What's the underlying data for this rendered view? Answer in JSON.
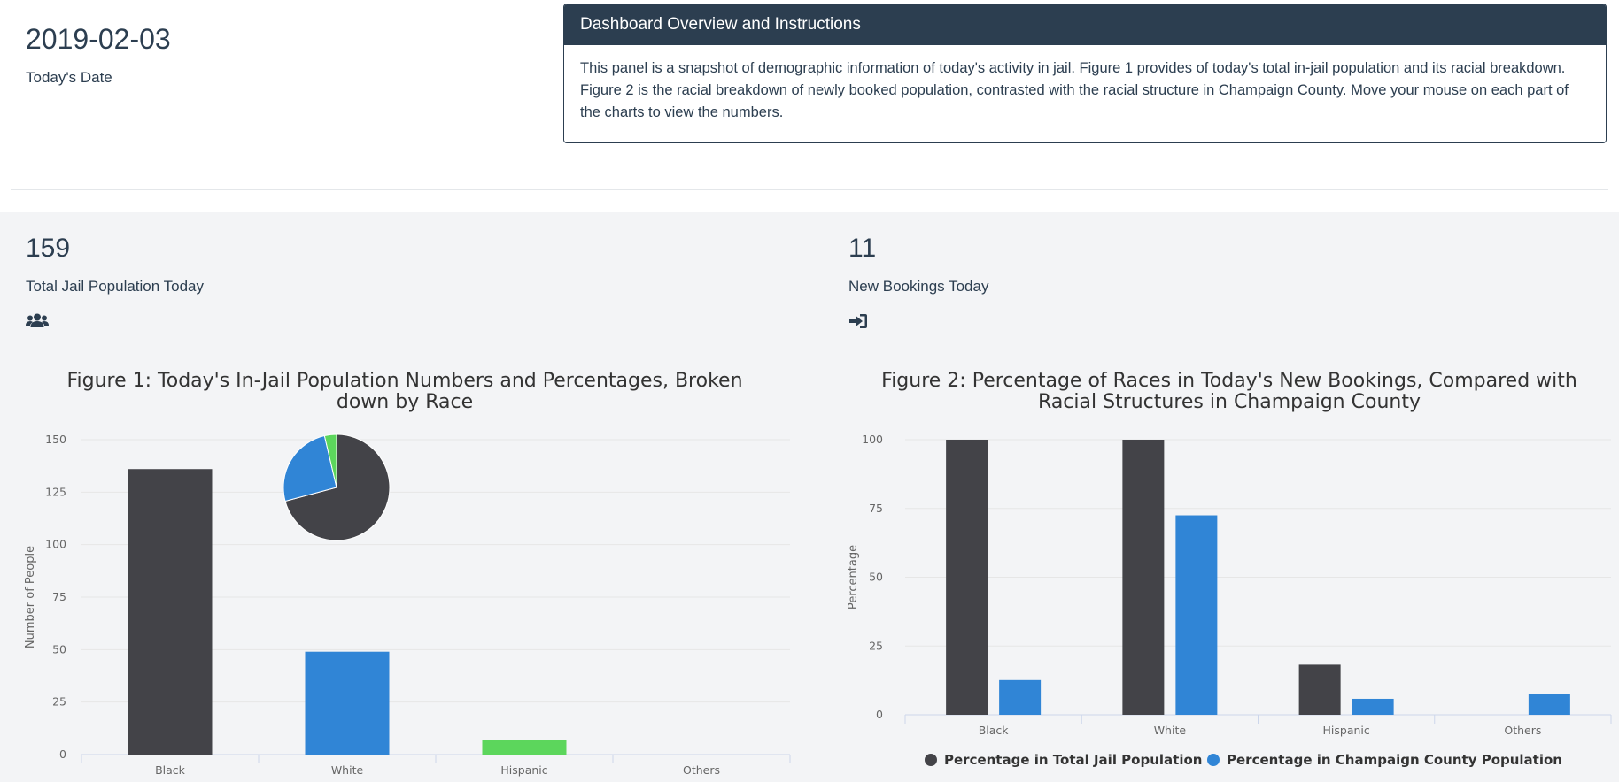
{
  "header": {
    "date": "2019-02-03",
    "date_label": "Today's Date"
  },
  "panel": {
    "title": "Dashboard Overview and Instructions",
    "body": "This panel is a snapshot of demographic information of today's activity in jail. Figure 1 provides of today's total in-jail population and its racial breakdown. Figure 2 is the racial breakdown of newly booked population, contrasted with the racial structure in Champaign County. Move your mouse on each part of the charts to view the numbers."
  },
  "stats": {
    "jail": {
      "value": "159",
      "label": "Total Jail Population Today",
      "icon": "users-icon"
    },
    "bookings": {
      "value": "11",
      "label": "New Bookings Today",
      "icon": "sign-in-icon"
    }
  },
  "colors": {
    "dark": "#434348",
    "blue": "#3085d6",
    "green": "#5cd65c",
    "navy": "#2c3e50"
  },
  "chart_data": [
    {
      "type": "bar",
      "title": "Figure 1: Today's In-Jail Population Numbers and Percentages, Broken down by Race",
      "title_lines": [
        "Figure 1: Today's In-Jail Population Numbers and Percentages, Broken",
        "down by Race"
      ],
      "categories": [
        "Black",
        "White",
        "Hispanic",
        "Others"
      ],
      "values": [
        136,
        49,
        7,
        0
      ],
      "bar_colors": [
        "#434348",
        "#3085d6",
        "#5cd65c",
        "#f7a35c"
      ],
      "ylabel": "Number of People",
      "ylim": [
        0,
        150
      ],
      "yticks": [
        0,
        25,
        50,
        75,
        100,
        125,
        150
      ],
      "grid": true,
      "inset_pie": {
        "type": "pie",
        "labels": [
          "Black",
          "White",
          "Hispanic"
        ],
        "values": [
          136,
          49,
          7
        ],
        "colors": [
          "#434348",
          "#3085d6",
          "#5cd65c"
        ]
      }
    },
    {
      "type": "bar",
      "title": "Figure 2: Percentage of Races in Today's New Bookings, Compared with Racial Structures in Champaign County",
      "title_lines": [
        "Figure 2: Percentage of Races in Today's New Bookings, Compared with",
        "Racial Structures in Champaign County"
      ],
      "categories": [
        "Black",
        "White",
        "Hispanic",
        "Others"
      ],
      "series": [
        {
          "name": "Percentage in Total Jail Population",
          "color": "#434348",
          "values": [
            100,
            100,
            18.2,
            0
          ]
        },
        {
          "name": "Percentage in Champaign County Population",
          "color": "#3085d6",
          "values": [
            12.6,
            72.5,
            5.8,
            7.7
          ]
        }
      ],
      "ylabel": "Percentage",
      "ylim": [
        0,
        100
      ],
      "yticks": [
        0,
        25,
        50,
        75,
        100
      ],
      "grid": true,
      "legend": "bottom-center"
    }
  ]
}
